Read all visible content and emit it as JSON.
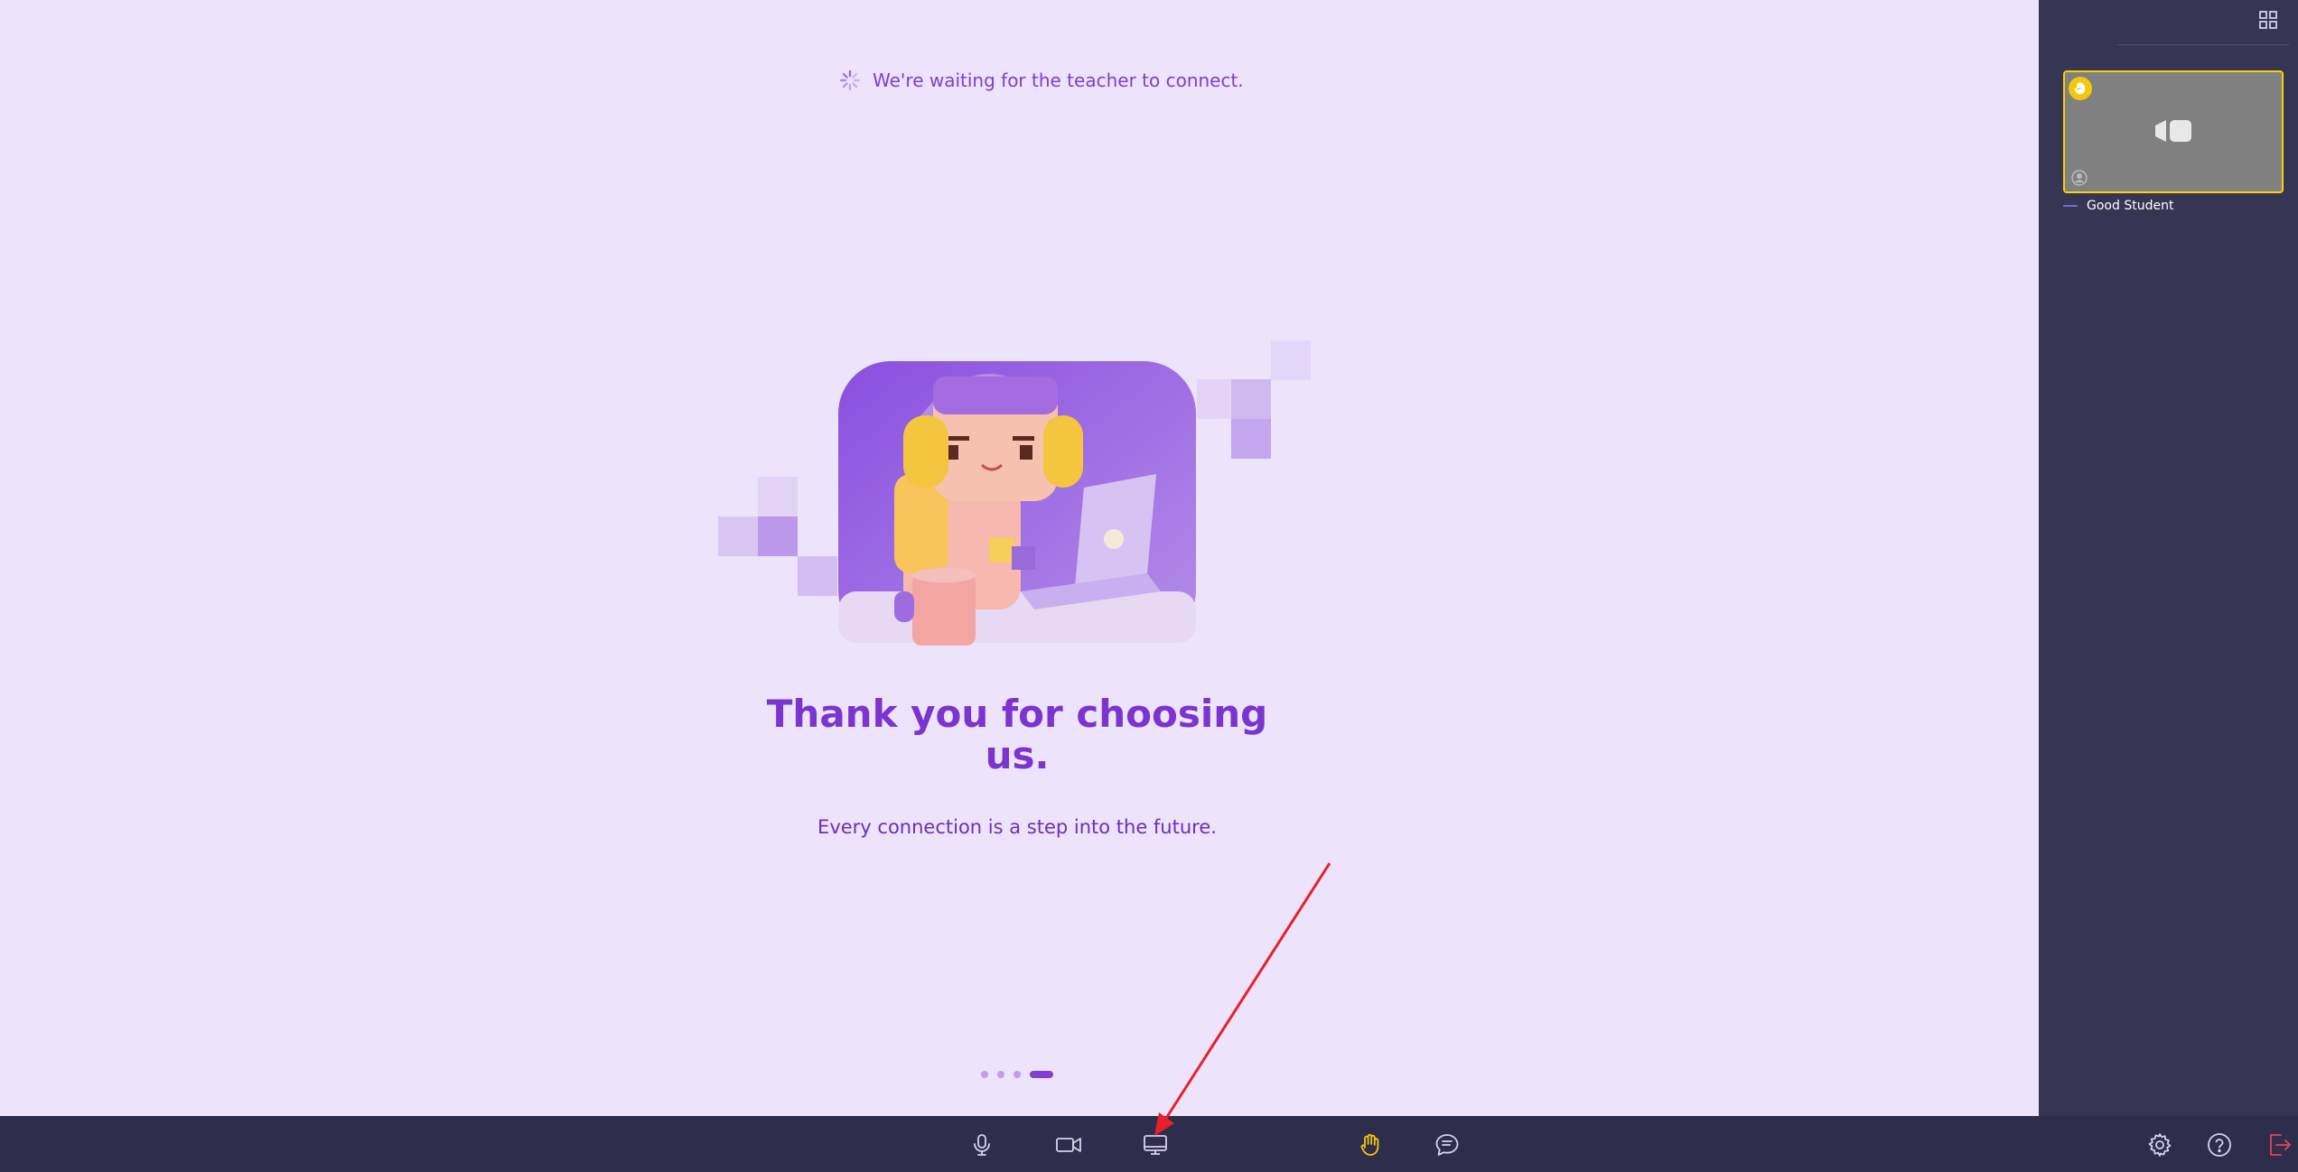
{
  "status": {
    "text": "We're waiting for the teacher to connect."
  },
  "slide": {
    "title": "Thank you for choosing us.",
    "subtitle": "Every connection is a step into the future.",
    "carousel": {
      "count": 4,
      "active_index": 3
    }
  },
  "participants": [
    {
      "name": "Good Student",
      "hand_raised": true,
      "camera_on": false
    }
  ],
  "icons": {
    "status": "spinner-icon",
    "grid": "grid-view-icon",
    "hand": "raise-hand-icon",
    "camera_off": "camera-off-icon",
    "avatar": "avatar-icon",
    "mic": "microphone-icon",
    "camera": "camera-icon",
    "screen": "screen-share-icon",
    "raise_hand": "raise-hand-icon",
    "chat": "chat-icon",
    "settings": "settings-icon",
    "help": "help-icon",
    "leave": "leave-icon"
  },
  "colors": {
    "stage_bg": "#ede3fa",
    "sidebar_bg": "#363554",
    "toolbar_bg": "#2e2d4b",
    "accent": "#7a34d0",
    "hand_yellow": "#f2c80a",
    "leave_red": "#e0455a",
    "annotation_red": "#e8202a"
  }
}
